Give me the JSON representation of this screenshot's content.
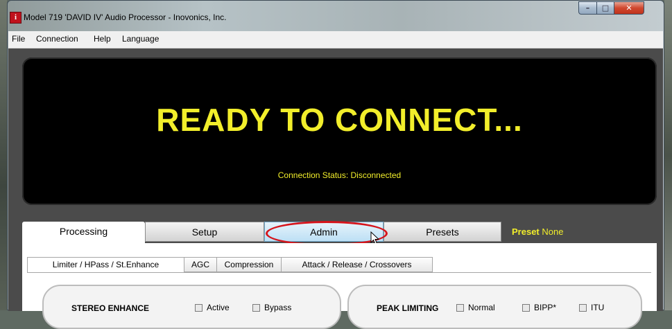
{
  "window": {
    "title": "Model 719 'DAVID IV' Audio Processor - Inovonics, Inc.",
    "app_icon_glyph": "i",
    "controls": {
      "minimize": "–",
      "maximize": "□",
      "close": "✕"
    }
  },
  "menubar": {
    "items": [
      "File",
      "Connection",
      "Help",
      "Language"
    ]
  },
  "display": {
    "headline": "READY TO CONNECT...",
    "status": "Connection Status: Disconnected",
    "text_color": "#f2ee2b"
  },
  "main_tabs": {
    "items": [
      "Processing",
      "Setup",
      "Admin",
      "Presets"
    ],
    "selected": "Processing",
    "hovered": "Admin"
  },
  "preset": {
    "label": "Preset",
    "value": "None"
  },
  "sub_tabs": {
    "items": [
      "Limiter / HPass / St.Enhance",
      "AGC",
      "Compression",
      "Attack / Release / Crossovers"
    ],
    "selected": "Limiter / HPass / St.Enhance"
  },
  "groups": {
    "stereo_enhance": {
      "title": "STEREO ENHANCE",
      "options": [
        "Active",
        "Bypass"
      ]
    },
    "peak_limiting": {
      "title": "PEAK LIMITING",
      "options": [
        "Normal",
        "BIPP*",
        "ITU"
      ]
    }
  },
  "annotation": {
    "highlight_color": "#d6141b"
  }
}
